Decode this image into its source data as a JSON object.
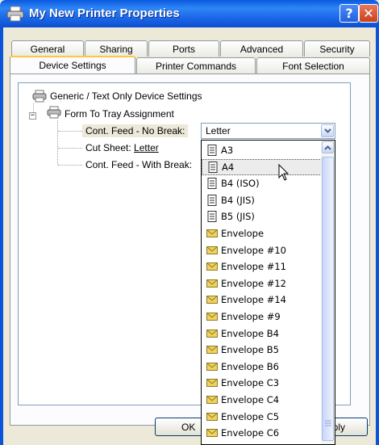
{
  "window": {
    "title": "My New Printer Properties",
    "help_label": "?",
    "close_label": "✕"
  },
  "tabs": {
    "row1": [
      "General",
      "Sharing",
      "Ports",
      "Advanced",
      "Security"
    ],
    "row2": [
      "Device Settings",
      "Printer Commands",
      "Font Selection"
    ],
    "active": "Device Settings"
  },
  "tree": {
    "root": "Generic / Text Only Device Settings",
    "group": "Form To Tray Assignment",
    "children": [
      {
        "label": "Cont. Feed - No Break:",
        "value": "Letter"
      },
      {
        "label": "Cut Sheet:",
        "value": "Letter"
      },
      {
        "label": "Cont. Feed - With Break:",
        "value": ""
      }
    ]
  },
  "combo": {
    "value": "Letter"
  },
  "dropdown": {
    "items": [
      {
        "label": "A3",
        "icon": "paper-icon"
      },
      {
        "label": "A4",
        "icon": "paper-icon",
        "hover": true
      },
      {
        "label": "B4 (ISO)",
        "icon": "paper-icon"
      },
      {
        "label": "B4 (JIS)",
        "icon": "paper-icon"
      },
      {
        "label": "B5 (JIS)",
        "icon": "paper-icon"
      },
      {
        "label": "Envelope",
        "icon": "envelope-icon"
      },
      {
        "label": "Envelope #10",
        "icon": "envelope-icon"
      },
      {
        "label": "Envelope #11",
        "icon": "envelope-icon"
      },
      {
        "label": "Envelope #12",
        "icon": "envelope-icon"
      },
      {
        "label": "Envelope #14",
        "icon": "envelope-icon"
      },
      {
        "label": "Envelope #9",
        "icon": "envelope-icon"
      },
      {
        "label": "Envelope B4",
        "icon": "envelope-icon"
      },
      {
        "label": "Envelope B5",
        "icon": "envelope-icon"
      },
      {
        "label": "Envelope B6",
        "icon": "envelope-icon"
      },
      {
        "label": "Envelope C3",
        "icon": "envelope-icon"
      },
      {
        "label": "Envelope C4",
        "icon": "envelope-icon"
      },
      {
        "label": "Envelope C5",
        "icon": "envelope-icon"
      },
      {
        "label": "Envelope C6",
        "icon": "envelope-icon"
      }
    ]
  },
  "buttons": {
    "ok": "OK",
    "apply_partial": "pply"
  },
  "colors": {
    "titlebar": "#0a59e0",
    "tab_accent": "#ffc83c",
    "envelope": "#f2d25c"
  }
}
